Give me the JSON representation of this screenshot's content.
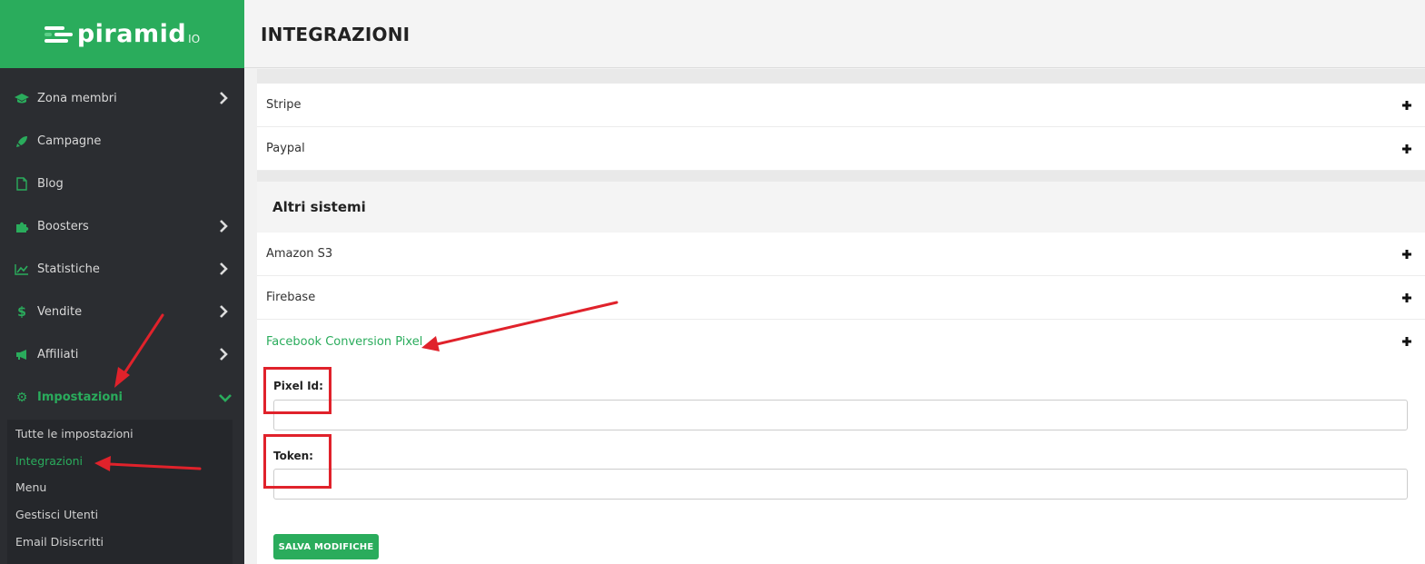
{
  "brand": {
    "name": "piramid",
    "suffix": "IO"
  },
  "sidebar": {
    "items": [
      {
        "label": "Zona membri",
        "icon": "graduation-cap-icon",
        "glyph": "🎓",
        "chevron": "right"
      },
      {
        "label": "Campagne",
        "icon": "rocket-icon",
        "glyph": "🚀",
        "chevron": ""
      },
      {
        "label": "Blog",
        "icon": "file-icon",
        "glyph": "🗋",
        "chevron": ""
      },
      {
        "label": "Boosters",
        "icon": "puzzle-icon",
        "glyph": "🧩",
        "chevron": "right"
      },
      {
        "label": "Statistiche",
        "icon": "line-chart-icon",
        "glyph": "📈",
        "chevron": "right"
      },
      {
        "label": "Vendite",
        "icon": "dollar-icon",
        "glyph": "$",
        "chevron": "right"
      },
      {
        "label": "Affiliati",
        "icon": "megaphone-icon",
        "glyph": "📢",
        "chevron": "right"
      },
      {
        "label": "Impostazioni",
        "icon": "gear-icon",
        "glyph": "⚙",
        "chevron": "down",
        "active": true
      }
    ],
    "submenu": [
      {
        "label": "Tutte le impostazioni"
      },
      {
        "label": "Integrazioni",
        "active": true
      },
      {
        "label": "Menu"
      },
      {
        "label": "Gestisci Utenti"
      },
      {
        "label": "Email Disiscritti"
      }
    ]
  },
  "header": {
    "title": "INTEGRAZIONI"
  },
  "payments": [
    {
      "label": "Stripe"
    },
    {
      "label": "Paypal"
    }
  ],
  "other_systems": {
    "title": "Altri sistemi",
    "items": [
      {
        "label": "Amazon S3"
      },
      {
        "label": "Firebase"
      },
      {
        "label": "Facebook Conversion Pixel",
        "expanded": true
      }
    ]
  },
  "form": {
    "pixel_id_label": "Pixel Id:",
    "pixel_id_value": "",
    "token_label": "Token:",
    "token_value": "",
    "save_label": "SALVA MODIFICHE"
  },
  "colors": {
    "accent": "#2aac5c",
    "sidebar": "#2b2d31",
    "annotation": "#e0222b"
  }
}
